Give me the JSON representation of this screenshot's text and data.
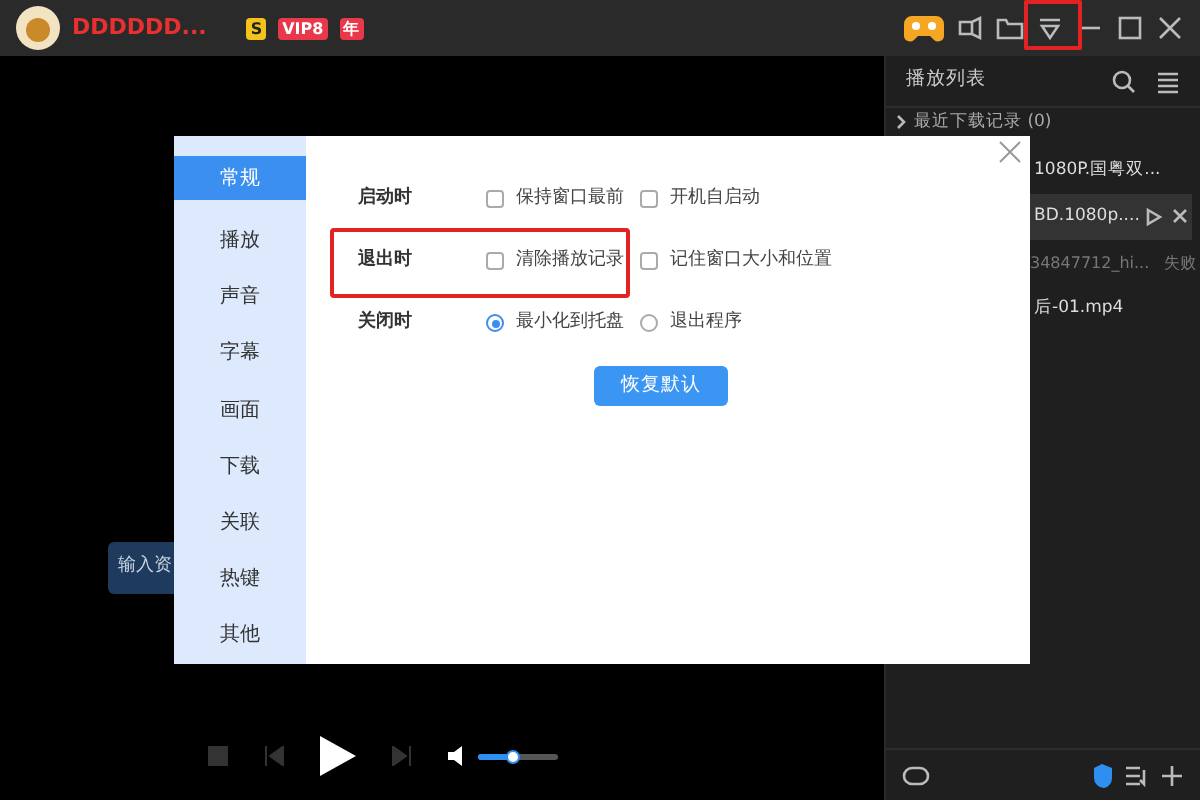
{
  "title_bar": {
    "user_name": "DDDDDD...",
    "badges": [
      {
        "text": "S",
        "kind": "s"
      },
      {
        "text": "VIP8",
        "kind": "vip"
      },
      {
        "text": "年",
        "kind": "year"
      }
    ],
    "collapse_highlighted": true
  },
  "playlist": {
    "title": "播放列表",
    "items": [
      {
        "title": "最近下载记录 (0)",
        "kind": "group"
      },
      {
        "title": "1080P.国粤双...",
        "kind": "playing"
      },
      {
        "title": "BD.1080p....",
        "kind": "hover"
      },
      {
        "title": "34847712_hi...",
        "status": "失败",
        "kind": "failed"
      },
      {
        "title": "后-01.mp4",
        "kind": "normal"
      }
    ]
  },
  "player": {
    "tooltip": "输入资",
    "volume": {
      "level": 0.45
    }
  },
  "settings": {
    "categories": [
      {
        "label": "常规",
        "selected": true
      },
      {
        "label": "播放",
        "selected": false
      },
      {
        "label": "声音",
        "selected": false
      },
      {
        "label": "字幕",
        "selected": false
      },
      {
        "label": "画面",
        "selected": false
      },
      {
        "label": "下载",
        "selected": false
      },
      {
        "label": "关联",
        "selected": false
      },
      {
        "label": "热键",
        "selected": false
      },
      {
        "label": "其他",
        "selected": false
      }
    ],
    "rows": [
      {
        "label": "启动时",
        "highlighted": false,
        "options": [
          {
            "kind": "checkbox",
            "label": "保持窗口最前",
            "checked": false
          },
          {
            "kind": "checkbox",
            "label": "开机自启动",
            "checked": false
          }
        ]
      },
      {
        "label": "退出时",
        "highlighted": true,
        "options": [
          {
            "kind": "checkbox",
            "label": "清除播放记录",
            "checked": false
          },
          {
            "kind": "checkbox",
            "label": "记住窗口大小和位置",
            "checked": false
          }
        ]
      },
      {
        "label": "关闭时",
        "highlighted": false,
        "options": [
          {
            "kind": "radio",
            "label": "最小化到托盘",
            "checked": true
          },
          {
            "kind": "radio",
            "label": "退出程序",
            "checked": false
          }
        ]
      }
    ],
    "reset_button": "恢复默认"
  }
}
